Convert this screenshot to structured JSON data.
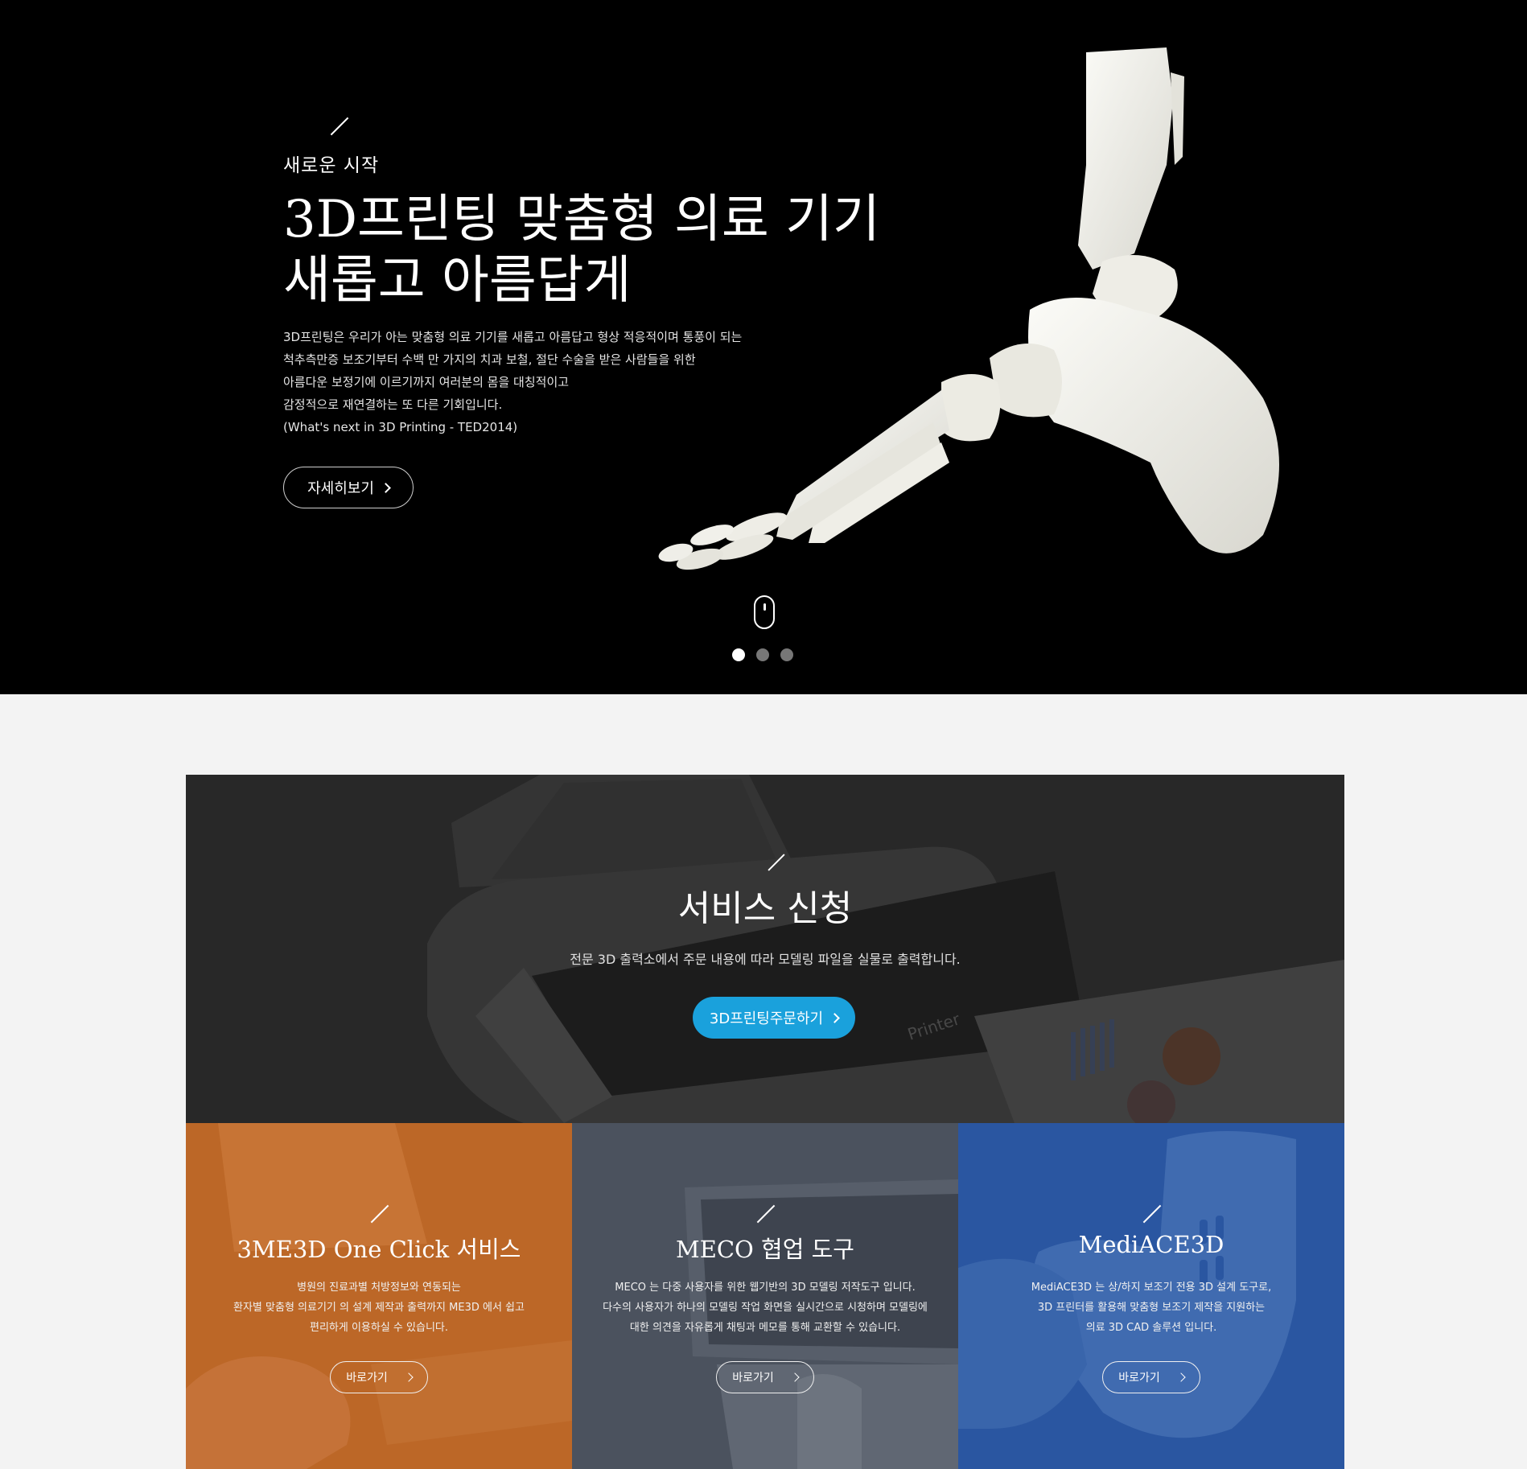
{
  "hero": {
    "eyebrow": "새로운 시작",
    "title_line1": "3D프린팅 맞춤형 의료 기기",
    "title_line2": "새롭고 아름답게",
    "desc": [
      "3D프린팅은 우리가 아는 맞춤형 의료 기기를 새롭고 아름답고 형상 적응적이며 통풍이 되는",
      "척추측만증 보조기부터 수백 만 가지의 치과 보철, 절단 수술을 받은 사람들을 위한",
      "아름다운 보정기에 이르기까지 여러분의 몸을 대칭적이고",
      "감정적으로 재연결하는 또 다른 기회입니다.",
      "(What's next in 3D Printing - TED2014)"
    ],
    "button_label": "자세히보기",
    "slide_count": 3,
    "active_slide": 1
  },
  "service": {
    "title": "서비스 신청",
    "desc": "전문 3D 출력소에서 주문 내용에 따라 모델링 파일을 실물로 출력합니다.",
    "button_label": "3D프린팅주문하기",
    "printer_label": "Printer"
  },
  "cards": [
    {
      "title": "3ME3D One Click 서비스",
      "desc": [
        "병원의 진료과별 처방정보와 연동되는",
        "환자별 맞춤형 의료기기 의 설계 제작과 출력까지 ME3D 에서 쉽고",
        "편리하게 이용하실 수 있습니다."
      ],
      "button_label": "바로가기"
    },
    {
      "title": "MECO 협업 도구",
      "desc": [
        "MECO 는 다중 사용자를 위한 웹기반의 3D 모델링 저작도구 입니다.",
        "다수의 사용자가 하나의 모델링 작업 화면을 실시간으로 시청하며 모델링에",
        "대한 의견을  자유롭게 채팅과 메모를 통해 교환할 수 있습니다."
      ],
      "button_label": "바로가기"
    },
    {
      "title": "MediACE3D",
      "desc": [
        "MediACE3D 는 상/하지 보조기 전용 3D 설계 도구로,",
        "3D 프린터를 활용해 맞춤형 보조기 제작을 지원하는",
        "의료 3D CAD 솔루션 입니다."
      ],
      "button_label": "바로가기"
    }
  ],
  "colors": {
    "accent": "#1aa1dc",
    "card1": "#c26a2c",
    "card2": "#4e5561",
    "card3": "#2d5aa5"
  }
}
